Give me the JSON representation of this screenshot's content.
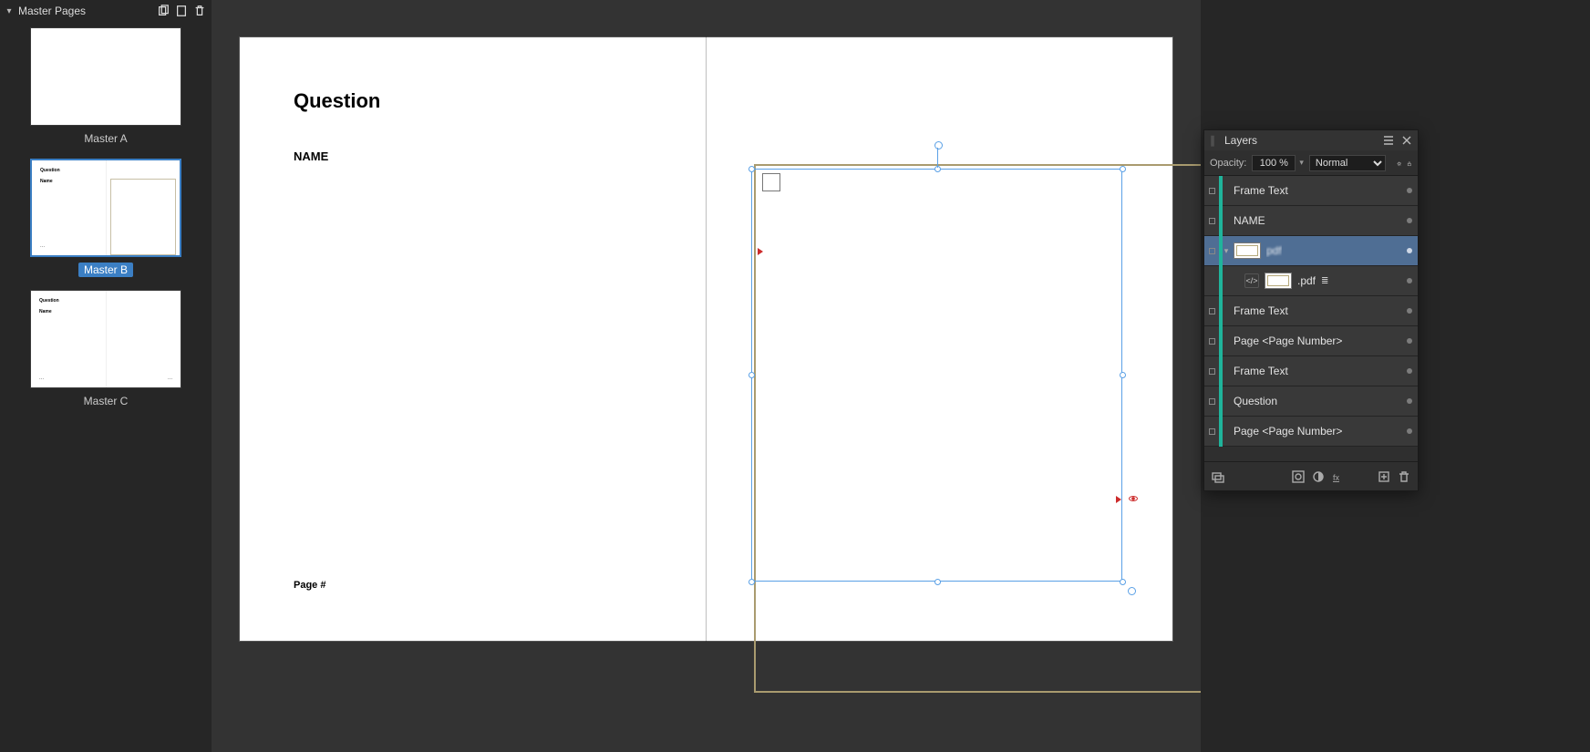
{
  "master_pages": {
    "title": "Master Pages",
    "items": [
      {
        "label": "Master A",
        "selected": false,
        "has_content": false
      },
      {
        "label": "Master B",
        "selected": true,
        "has_content": true,
        "show_frame": true
      },
      {
        "label": "Master C",
        "selected": false,
        "has_content": true,
        "show_frame": false
      }
    ]
  },
  "canvas": {
    "heading": "Question",
    "name_label": "NAME",
    "page_number_label": "Page #"
  },
  "layers_panel": {
    "title": "Layers",
    "opacity_label": "Opacity:",
    "opacity_value": "100 %",
    "blend_mode": "Normal",
    "rows": [
      {
        "name": "Frame Text",
        "selected": false,
        "has_thumb": false
      },
      {
        "name": "NAME",
        "selected": false,
        "has_thumb": false
      },
      {
        "name": "",
        "selected": true,
        "has_thumb": true,
        "blur": true
      },
      {
        "name": ".pdf",
        "selected": false,
        "has_thumb": true,
        "child": true,
        "embed": true
      },
      {
        "name": "Frame Text",
        "selected": false,
        "has_thumb": false
      },
      {
        "name": "Page <Page Number>",
        "selected": false,
        "has_thumb": false
      },
      {
        "name": "Frame Text",
        "selected": false,
        "has_thumb": false
      },
      {
        "name": "Question",
        "selected": false,
        "has_thumb": false
      },
      {
        "name": "Page <Page Number>",
        "selected": false,
        "has_thumb": false
      }
    ]
  }
}
